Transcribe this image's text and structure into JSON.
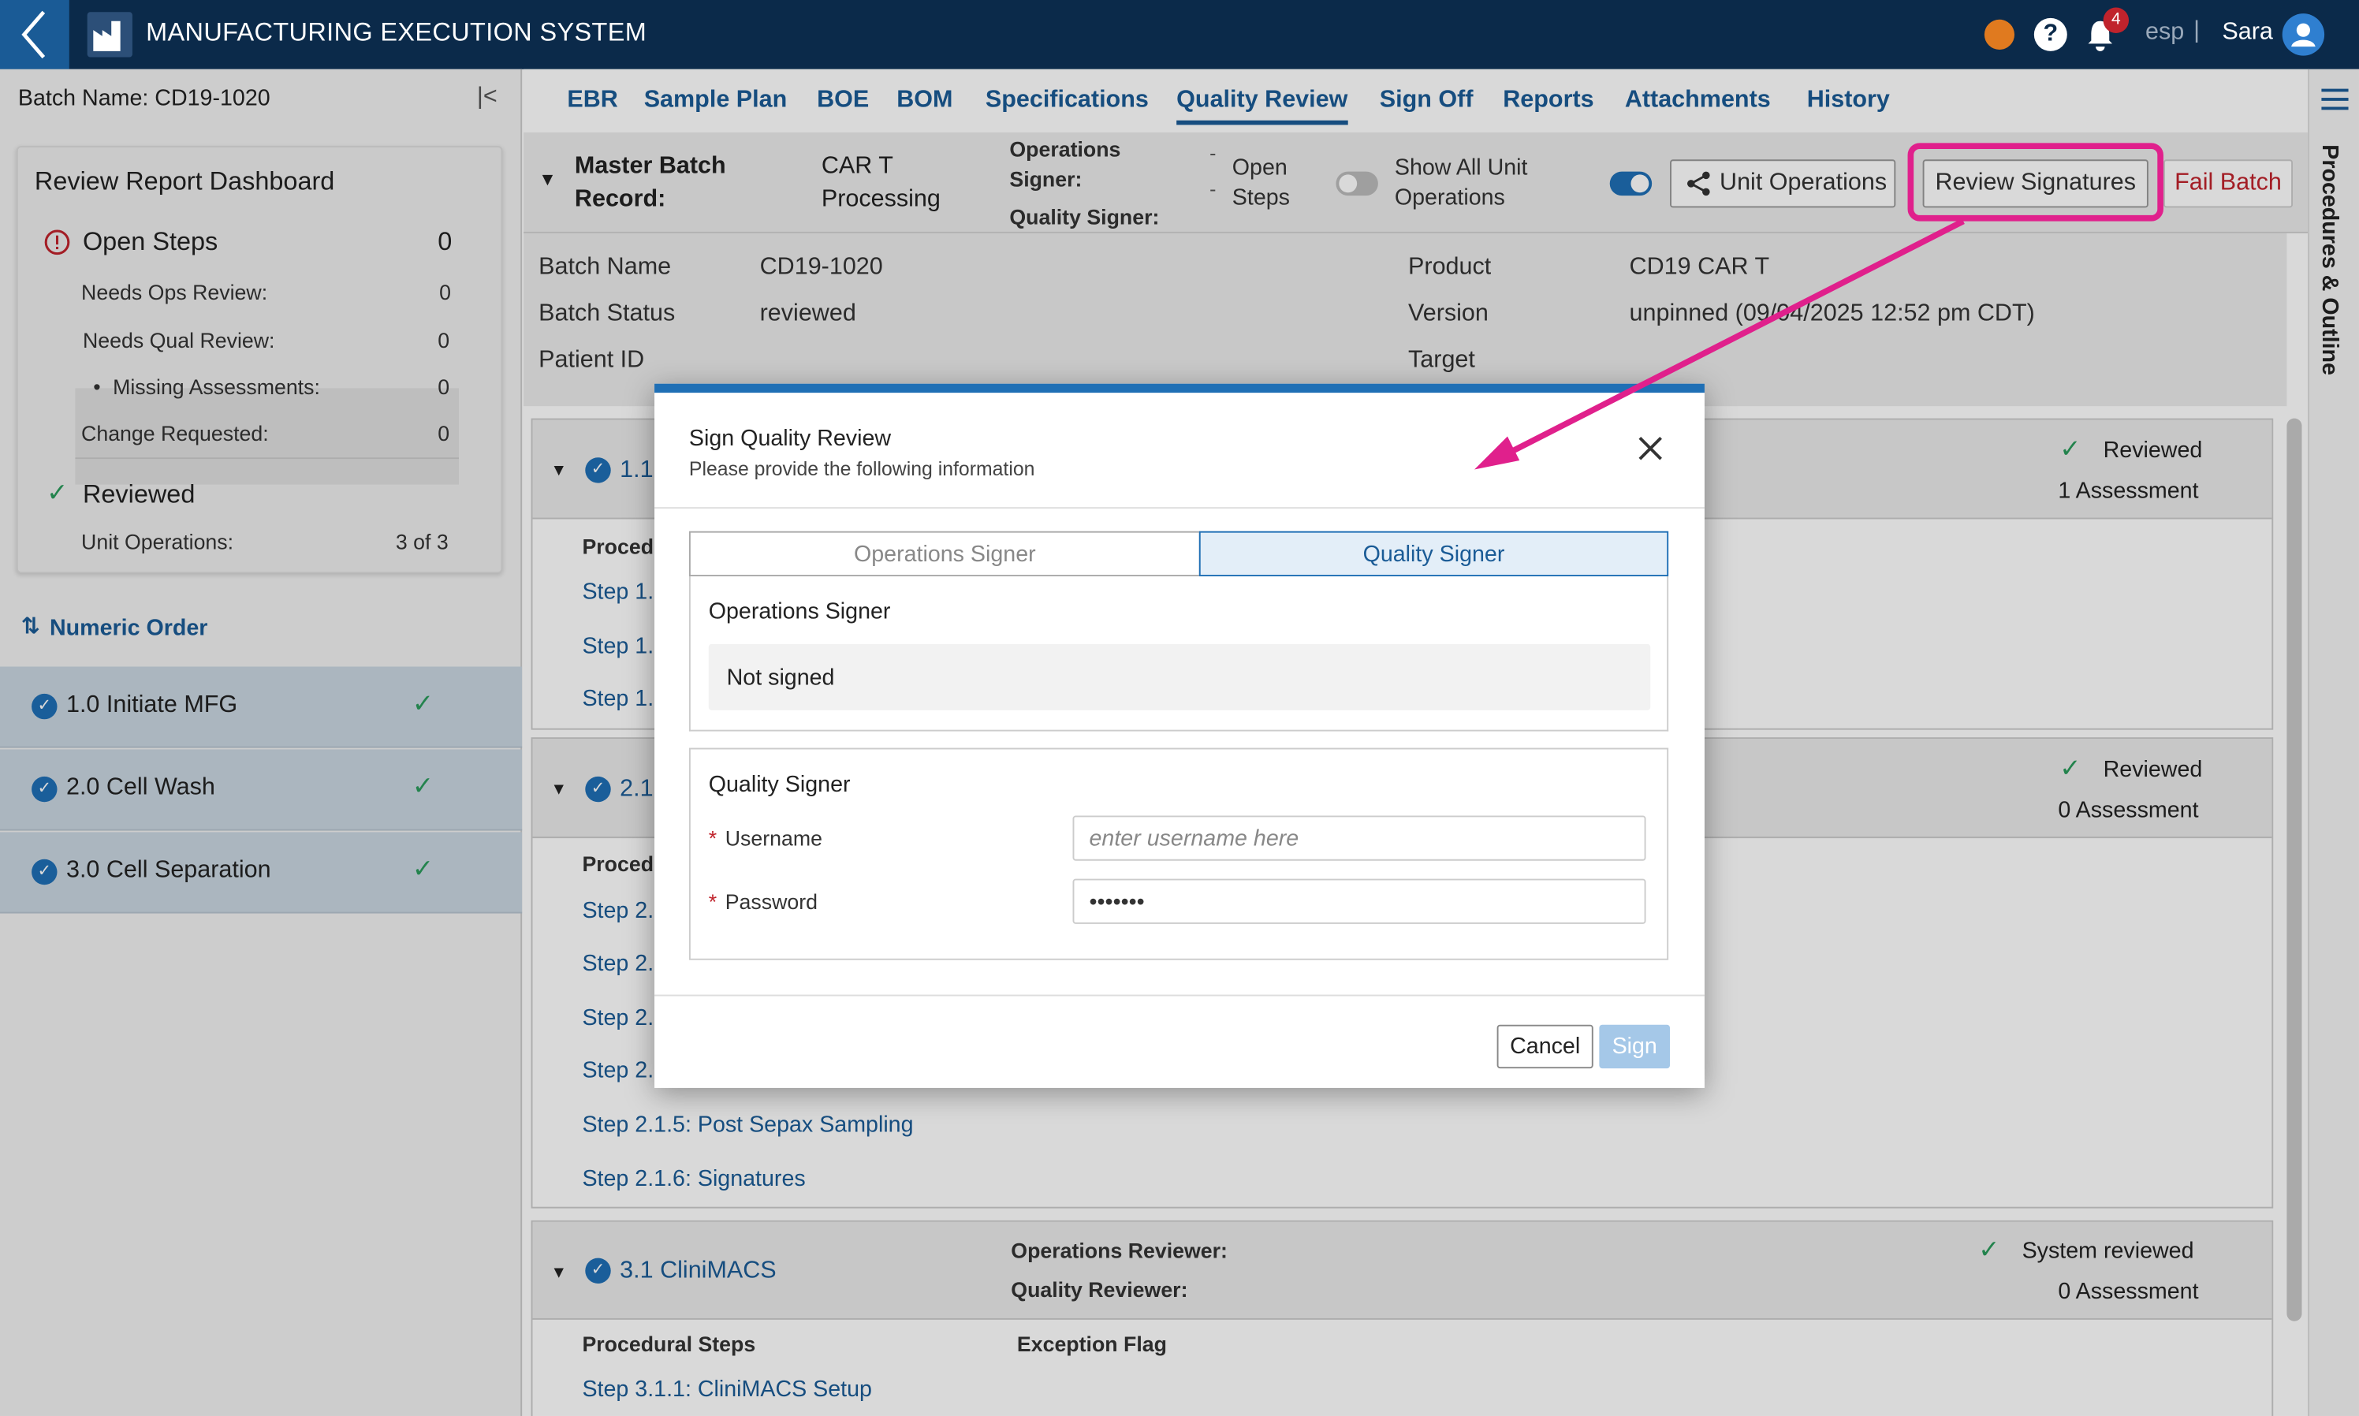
{
  "app": {
    "title": "MANUFACTURING EXECUTION SYSTEM",
    "notifications": "4",
    "org": "esp",
    "org_sep": "|",
    "user": "Sara"
  },
  "left": {
    "batch_label": "Batch Name: CD19-1020",
    "dashboard_title": "Review Report Dashboard",
    "open_steps_label": "Open Steps",
    "open_steps_count": "0",
    "rows": [
      {
        "label": "Needs Ops Review:",
        "value": "0"
      },
      {
        "label": "Needs Qual Review:",
        "value": "0"
      },
      {
        "label": "Missing Assessments:",
        "value": "0"
      },
      {
        "label": "Change Requested:",
        "value": "0"
      }
    ],
    "reviewed_label": "Reviewed",
    "unit_ops_label": "Unit Operations:",
    "unit_ops_value": "3 of 3",
    "order_label": "Numeric Order",
    "unit_ops": [
      {
        "label": "1.0 Initiate MFG"
      },
      {
        "label": "2.0 Cell Wash"
      },
      {
        "label": "3.0 Cell Separation"
      }
    ]
  },
  "tabs": [
    "EBR",
    "Sample Plan",
    "BOE",
    "BOM",
    "Specifications",
    "Quality Review",
    "Sign Off",
    "Reports",
    "Attachments",
    "History"
  ],
  "master": {
    "label": "Master Batch Record:",
    "label1": "Master Batch",
    "label2": "Record:",
    "value1": "CAR T",
    "value2": "Processing",
    "ops_signer": "Operations Signer:",
    "ops1": "Operations",
    "ops2": "Signer:",
    "qual_signer": "Quality Signer:",
    "dash": "-",
    "open_steps1": "Open",
    "open_steps2": "Steps",
    "show_all1": "Show All Unit",
    "show_all2": "Operations",
    "unit_ops_btn": "Unit Operations",
    "review_sig_btn": "Review Signatures",
    "fail_btn": "Fail Batch"
  },
  "info": {
    "batch_name_label": "Batch Name",
    "batch_name": "CD19-1020",
    "status_label": "Batch Status",
    "status": "reviewed",
    "patient_label": "Patient ID",
    "product_label": "Product",
    "product": "CD19 CAR T",
    "version_label": "Version",
    "version": "unpinned (09/04/2025 12:52 pm CDT)",
    "target_label": "Target"
  },
  "cards": {
    "c1_num": "1.1",
    "c1_status": "Reviewed",
    "c1_assess": "1 Assessment",
    "proc": "Procedu",
    "steps1": [
      "Step 1.",
      "Step 1.",
      "Step 1."
    ],
    "c2_num": "2.1",
    "c2_status": "Reviewed",
    "c2_assess": "0 Assessment",
    "steps2": [
      "Step 2.",
      "Step 2.",
      "Step 2.",
      "Step 2.",
      "Step 2.1.5: Post Sepax Sampling",
      "Step 2.1.6: Signatures"
    ],
    "c3_title": "3.1 CliniMACS",
    "c3_ops": "Operations Reviewer:",
    "c3_qual": "Quality Reviewer:",
    "c3_status": "System reviewed",
    "c3_assess": "0 Assessment",
    "c3_proc": "Procedural Steps",
    "c3_flag": "Exception Flag",
    "c3_step": "Step 3.1.1: CliniMACS Setup"
  },
  "rail": "Procedures & Outline",
  "dialog": {
    "title": "Sign Quality Review",
    "subtitle": "Please provide the following information",
    "tab_ops": "Operations Signer",
    "tab_qual": "Quality Signer",
    "ops_section": "Operations Signer",
    "not_signed": "Not signed",
    "qual_section": "Quality Signer",
    "username_label": "Username",
    "username_placeholder": "enter username here",
    "password_label": "Password",
    "password_value": "•••••••",
    "cancel": "Cancel",
    "sign": "Sign",
    "required": "*"
  },
  "colors": {
    "accent": "#1a5b96",
    "highlight": "#e0208c",
    "fail": "#c0232c",
    "success": "#2a9a5b"
  }
}
